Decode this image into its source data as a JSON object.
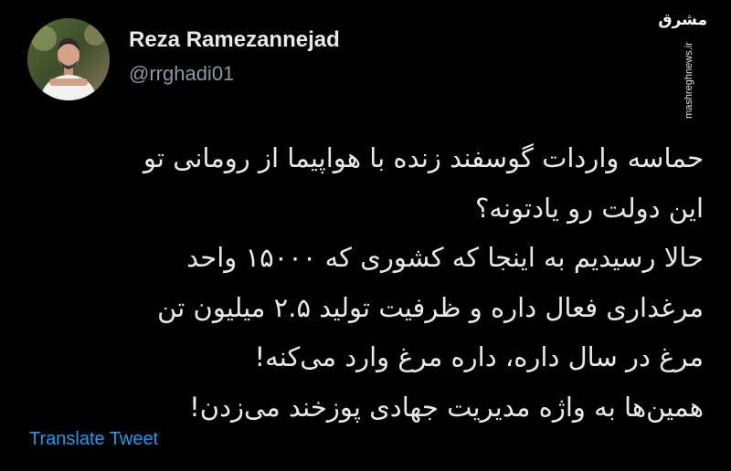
{
  "author": {
    "name": "Reza Ramezannejad",
    "handle": "@rrghadi01"
  },
  "avatar": {
    "icon": "profile-photo"
  },
  "watermark": {
    "logo_text": "مشرق",
    "site": "mashreghnews.ir"
  },
  "tweet": {
    "lines": [
      "حماسه واردات گوسفند زنده با هواپیما از رومانی تو",
      "این دولت رو یادتونه؟",
      "حالا رسیدیم به اینجا که کشوری که ۱۵۰۰۰ واحد",
      "مرغداری فعال داره و ظرفیت تولید ۲.۵ میلیون تن",
      "مرغ در سال داره، داره مرغ وارد می‌کنه!",
      "همین‌ها به واژه مدیریت جهادی پوزخند می‌زدن!"
    ]
  },
  "actions": {
    "translate_label": "Translate Tweet"
  },
  "colors": {
    "background": "#000000",
    "text": "#e7e9ea",
    "handle": "#8b98a5",
    "link": "#1d9bf0"
  }
}
